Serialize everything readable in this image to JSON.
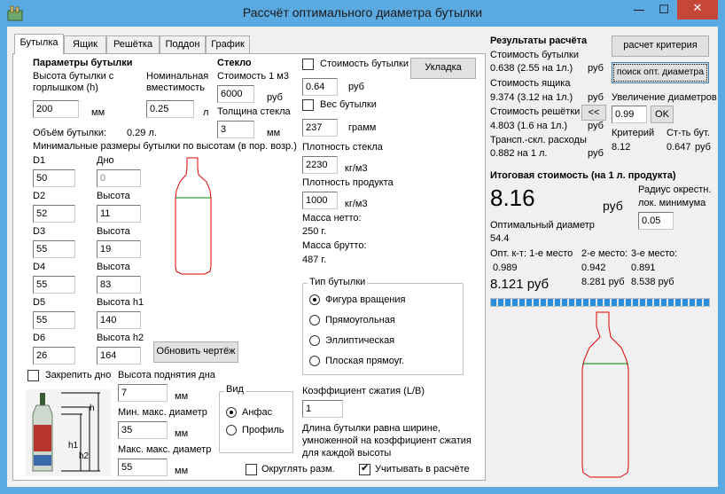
{
  "window": {
    "title": "Рассчёт оптимального диаметра бутылки",
    "minimize": "—",
    "maximize": "☐",
    "close": "✕"
  },
  "tabs": [
    {
      "label": "Бутылка",
      "active": true
    },
    {
      "label": "Ящик"
    },
    {
      "label": "Решётка"
    },
    {
      "label": "Поддон"
    },
    {
      "label": "График"
    }
  ],
  "bottle_params": {
    "heading": "Параметры бутылки",
    "height_label_1": "Высота бутылки с",
    "height_label_2": "горлышком (h)",
    "height_value": "200",
    "height_unit": "мм",
    "nominal_label_1": "Номинальная",
    "nominal_label_2": "вместимость",
    "nominal_value": "0.25",
    "nominal_unit": "л",
    "volume_label": "Объём бутылки:",
    "volume_value": "0.29 л.",
    "min_sizes_label": "Минимальные размеры бутылки по высотам (в пор. возр.)",
    "rows": [
      {
        "d_label": "D1",
        "d_value": "50",
        "h_label": "Дно",
        "h_value": "0"
      },
      {
        "d_label": "D2",
        "d_value": "52",
        "h_label": "Высота",
        "h_value": "11"
      },
      {
        "d_label": "D3",
        "d_value": "55",
        "h_label": "Высота",
        "h_value": "19"
      },
      {
        "d_label": "D4",
        "d_value": "55",
        "h_label": "Высота",
        "h_value": "83"
      },
      {
        "d_label": "D5",
        "d_value": "55",
        "h_label": "Высота h1",
        "h_value": "140"
      },
      {
        "d_label": "D6",
        "d_value": "26",
        "h_label": "Высота h2",
        "h_value": "164"
      }
    ],
    "update_drawing_button": "Обновить чертёж",
    "fix_bottom_label": "Закрепить дно"
  },
  "lift": {
    "label": "Высота поднятия дна",
    "value": "7",
    "unit": "мм",
    "min_max_label": "Мин. макс. диаметр",
    "min_max_value": "35",
    "min_max_unit": "мм",
    "max_max_label": "Макс. макс. диаметр",
    "max_max_value": "55",
    "max_max_unit": "мм"
  },
  "photo_labels": {
    "h": "h",
    "h1": "h1",
    "h2": "h2"
  },
  "view": {
    "caption": "Вид",
    "options": [
      "Анфас",
      "Профиль"
    ],
    "selected": 0
  },
  "glass": {
    "heading": "Стекло",
    "cost_label": "Стоимость 1 м3",
    "cost_value": "6000",
    "cost_unit": "руб",
    "thickness_label": "Толщина стекла",
    "thickness_value": "3",
    "thickness_unit": "мм"
  },
  "bottle_cost": {
    "label": "Стоимость бутылки",
    "value": "0.64",
    "unit": "руб",
    "checked": false
  },
  "bottle_weight": {
    "label": "Вес бутылки",
    "value": "237",
    "unit": "грамм",
    "checked": false
  },
  "packing_button": "Укладка",
  "density_glass": {
    "label": "Плотность стекла",
    "value": "2230",
    "unit": "кг/м3"
  },
  "density_product": {
    "label": "Плотность продукта",
    "value": "1000",
    "unit": "кг/м3"
  },
  "mass_net": {
    "label": "Масса нетто:",
    "value": "250 г."
  },
  "mass_gross": {
    "label": "Масса брутто:",
    "value": "487 г."
  },
  "bottle_type": {
    "caption": "Тип бутылки",
    "options": [
      "Фигура вращения",
      "Прямоугольная",
      "Эллиптическая",
      "Плоская прямоуг."
    ],
    "selected": 0
  },
  "compression": {
    "label": "Коэффициент сжатия (L/B)",
    "value": "1",
    "note_1": "Длина бутылки равна ширине,",
    "note_2": "умноженной на коэффициент сжатия",
    "note_3": "для каждой высоты"
  },
  "round_sizes": {
    "label": "Округлять разм.",
    "checked": false
  },
  "use_in_calc": {
    "label": "Учитывать в расчёте",
    "checked": true
  },
  "results": {
    "heading": "Результаты расчёта",
    "criterion_button": "расчет критерия",
    "search_button": "поиск опт. диаметра",
    "bottle_cost_label": "Стоимость бутылки",
    "bottle_cost_value": "0.638 (2.55 на 1л.)",
    "bottle_cost_unit": "руб",
    "box_cost_label": "Стоимость ящика",
    "box_cost_value": "9.374 (3.12 на 1л.)",
    "box_cost_unit": "руб",
    "grid_cost_label": "Стоимость решётки",
    "grid_cost_value": "4.803 (1.6 на 1л.)",
    "grid_cost_unit": "руб",
    "transport_label": "Трансп.-скл. расходы",
    "transport_value": "0.882 на 1 л.",
    "transport_unit": "руб",
    "prev_button": "<<",
    "increase_label": "Увеличение диаметров",
    "increase_value": "0.99",
    "ok_button": "OK",
    "criterion_label": "Критерий",
    "criterion_value": "8.12",
    "cost_bottle_label": "Ст-ть бут.",
    "cost_bottle_value": "0.647",
    "cost_bottle_unit": "руб"
  },
  "total": {
    "heading": "Итоговая стоимость (на 1 л. продукта)",
    "value": "8.16",
    "unit": "руб",
    "radius_label_1": "Радиус окрестн.",
    "radius_label_2": "лок. минимума",
    "radius_value": "0.05",
    "opt_diameter_label": "Оптимальный диаметр",
    "opt_diameter_value": "54.4",
    "place_1_label": "Опт. к-т: 1-е место",
    "place_1_value": "0.989",
    "place_1_cost": "8.121 руб",
    "place_2_label": "2-е место:",
    "place_2_value": "0.942",
    "place_2_cost": "8.281 руб",
    "place_3_label": "3-е место:",
    "place_3_value": "0.891",
    "place_3_cost": "8.538 руб",
    "progress": 1.0
  },
  "colors": {
    "bottle_outline": "#e00000",
    "bottle_neckline": "#008000",
    "progress": "#2b8fd9",
    "titlebar": "#5aa9e0"
  }
}
